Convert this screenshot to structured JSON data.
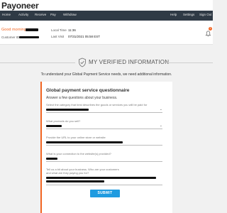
{
  "brand": {
    "logo_text": "Payoneer",
    "accent": "#f26522",
    "nav_bg": "#2f3a45",
    "button_color": "#1f9be0"
  },
  "nav": {
    "left": [
      "Home",
      "Activity",
      "Receive",
      "Pay",
      "Withdraw"
    ],
    "right": [
      "Help",
      "Settings",
      "Sign Out"
    ]
  },
  "user": {
    "greeting": "Good morning,",
    "customer_id_label": "Customer ID",
    "local_time_label": "Local Time",
    "local_time_value": "11:36",
    "last_visit_label": "Last Visit",
    "last_visit_value": "07/31/2021 05:58 EST",
    "notifications_count": "1"
  },
  "page": {
    "heading": "MY VERIFIED INFORMATION",
    "intro": "To understand your Global Payment Service needs, we need additional information."
  },
  "questionnaire": {
    "title": "Global payment service questionnaire",
    "subtitle": "Answer a few questions about your business.",
    "fields": [
      {
        "label": "Select the category that best describes the goods or services you will be paid for",
        "type": "select"
      },
      {
        "label": "What products do you sell?",
        "type": "select"
      },
      {
        "label": "Provide the URL to your online store or website",
        "type": "text"
      },
      {
        "label": "What is your connection to the website(s) provided?",
        "type": "text"
      },
      {
        "label": "Tell us a bit about your business. Who are your customers and what are they paying you for?",
        "type": "textarea"
      }
    ],
    "submit_label": "SUBMIT"
  }
}
